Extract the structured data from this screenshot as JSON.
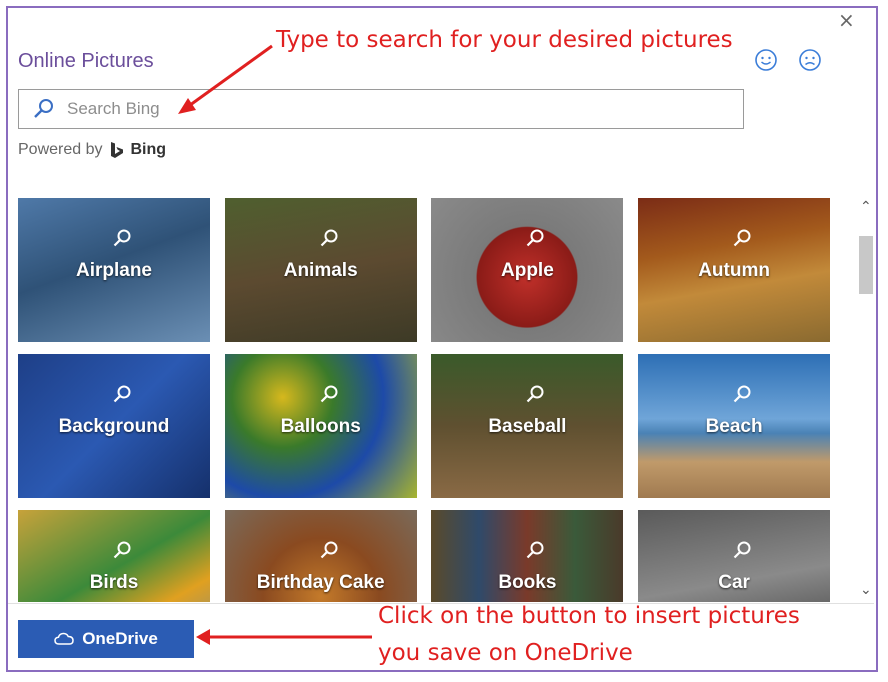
{
  "dialog": {
    "title": "Online Pictures",
    "close_icon": "×"
  },
  "search": {
    "placeholder": "Search Bing"
  },
  "powered_by": {
    "label": "Powered by",
    "brand": "Bing"
  },
  "tiles": [
    {
      "label": "Airplane",
      "bg": "linear-gradient(160deg,#4f79a8 0%,#2f5277 45%,#6b8fb4 100%)"
    },
    {
      "label": "Animals",
      "bg": "linear-gradient(170deg,#4f5f2f 0%,#5c4a30 50%,#3d3a26 100%)"
    },
    {
      "label": "Apple",
      "bg": "radial-gradient(circle at 50% 55%,#c0302a 0%,#8a1b17 40%,#7a7a7a 41%,#8a8a8a 100%)"
    },
    {
      "label": "Autumn",
      "bg": "linear-gradient(170deg,#7b2c16 0%,#a35a1c 35%,#c28a3a 60%,#8a6a30 100%)"
    },
    {
      "label": "Background",
      "bg": "linear-gradient(135deg,#1e3f87 0%,#2b59b2 50%,#15306b 100%)"
    },
    {
      "label": "Balloons",
      "bg": "radial-gradient(circle at 30% 30%,#d6b81d 0%,#3a7a2a 30%,#1d4aa8 60%,#a8b52e 100%)"
    },
    {
      "label": "Baseball",
      "bg": "linear-gradient(180deg,#3a5a2a 0%,#5f5030 50%,#8a6a45 100%)"
    },
    {
      "label": "Beach",
      "bg": "linear-gradient(180deg,#2d6fb5 0%,#6fa5d8 45%,#4a82b5 55%,#c09a6a 75%,#a07a50 100%)"
    },
    {
      "label": "Birds",
      "bg": "linear-gradient(150deg,#c7a23a 0%,#3c8a3a 45%,#e0a020 70%,#7a8a8a 100%)"
    },
    {
      "label": "Birthday Cake",
      "bg": "radial-gradient(circle at 50% 60%,#c47a2a 0%,#8a4a20 45%,#7a6a5a 100%)"
    },
    {
      "label": "Books",
      "bg": "linear-gradient(90deg,#5a4a2a 0%,#2f4a6a 25%,#7a3a2a 50%,#3a5a3a 75%,#4a3a2a 100%)"
    },
    {
      "label": "Car",
      "bg": "linear-gradient(170deg,#5a5a5a 0%,#8a8a8a 50%,#3a3a3a 100%)"
    }
  ],
  "scrollbar": {
    "up": "⌃",
    "down": "⌄"
  },
  "onedrive": {
    "label": "OneDrive"
  },
  "annotations": {
    "top": "Type to search for your desired pictures",
    "bottom_line1": "Click on the button to insert pictures",
    "bottom_line2": "you save on OneDrive"
  }
}
